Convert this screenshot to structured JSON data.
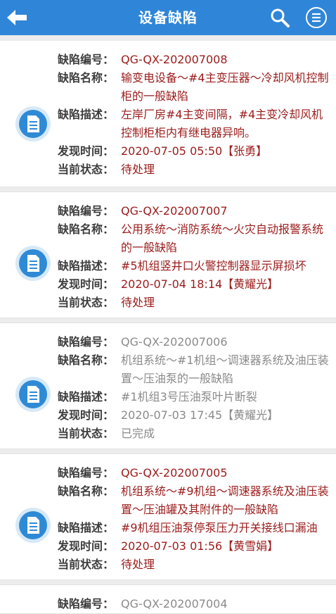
{
  "header": {
    "title": "设备缺陷"
  },
  "labels": {
    "id": "缺陷编号：",
    "name": "缺陷名称：",
    "desc": "缺陷描述：",
    "time": "发现时间：",
    "status": "当前状态："
  },
  "defects": [
    {
      "id": "QG-QX-202007008",
      "name": "输变电设备～#4主变压器～冷却风机控制柜的一般缺陷",
      "desc": "左岸厂房#4主变间隔，#4主变冷却风机控制柜柜内有继电器异响。",
      "time": "2020-07-05 05:50【张勇】",
      "status": "待处理"
    },
    {
      "id": "QG-QX-202007007",
      "name": "公用系统～消防系统～火灾自动报警系统的一般缺陷",
      "desc": "#5机组竖井口火警控制器显示屏损坏",
      "time": "2020-07-04 18:14【黄耀光】",
      "status": "待处理"
    },
    {
      "id": "QG-QX-202007006",
      "name": "机组系统～#1机组～调速器系统及油压装置～压油泵的一般缺陷",
      "desc": "#1机组3号压油泵叶片断裂",
      "time": "2020-07-03 17:45【黄耀光】",
      "status": "已完成"
    },
    {
      "id": "QG-QX-202007005",
      "name": "机组系统～#9机组～调速器系统及油压装置～压油罐及其附件的一般缺陷",
      "desc": "#9机组压油泵停泵压力开关接线口漏油",
      "time": "2020-07-03 01:56【黄雪娟】",
      "status": "待处理"
    },
    {
      "id": "QG-QX-202007004"
    }
  ]
}
